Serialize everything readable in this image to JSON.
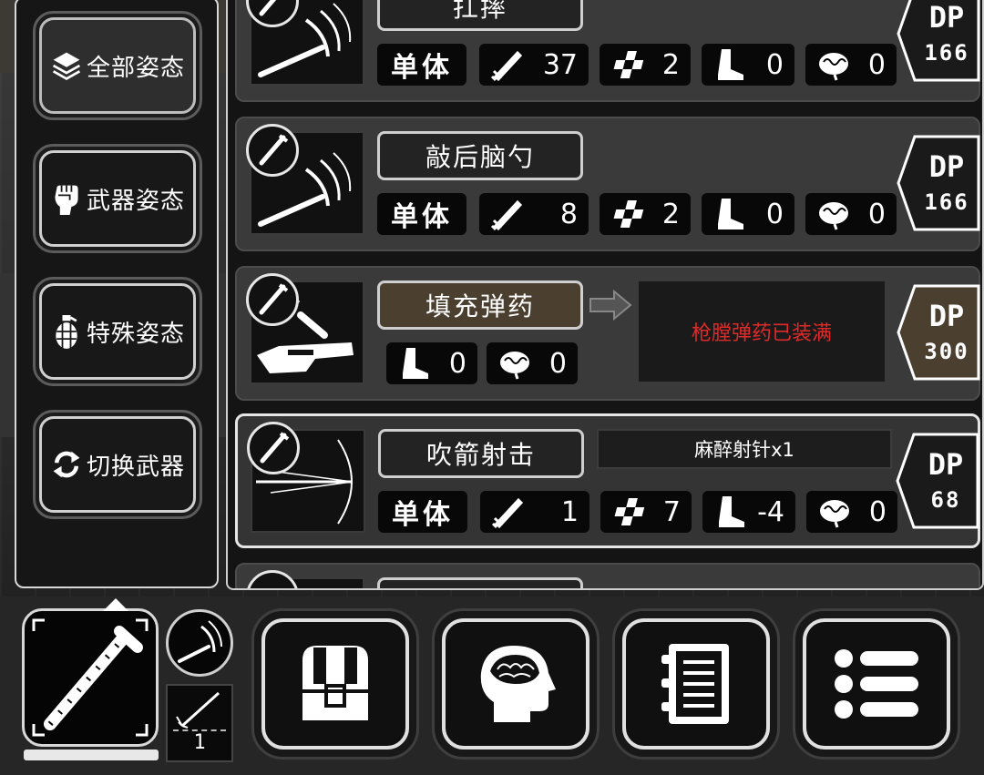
{
  "stance_menu": {
    "items": [
      {
        "label": "全部姿态",
        "icon": "layers-icon"
      },
      {
        "label": "武器姿态",
        "icon": "fist-icon"
      },
      {
        "label": "特殊姿态",
        "icon": "grenade-icon"
      },
      {
        "label": "切换武器",
        "icon": "swap-icon"
      }
    ]
  },
  "skills": [
    {
      "name": "扛摔",
      "target": "单体",
      "attack": "37",
      "range": "2",
      "move": "0",
      "mind": "0",
      "dp_label": "DP",
      "dp": "166"
    },
    {
      "name": "敲后脑勺",
      "target": "单体",
      "attack": "8",
      "range": "2",
      "move": "0",
      "mind": "0",
      "dp_label": "DP",
      "dp": "166"
    },
    {
      "name": "填充弹药",
      "move": "0",
      "mind": "0",
      "info": "枪膛弹药已装满",
      "dp_label": "DP",
      "dp": "300"
    },
    {
      "name": "吹箭射击",
      "note": "麻醉射针x1",
      "target": "单体",
      "attack": "1",
      "range": "7",
      "move": "-4",
      "mind": "0",
      "dp_label": "DP",
      "dp": "68"
    }
  ],
  "bottom_bar": {
    "ammo_count": "1",
    "weapon_durability": 1.0,
    "menu_buttons": [
      "backpack-icon",
      "brain-head-icon",
      "notebook-icon",
      "list-icon"
    ]
  },
  "colors": {
    "panel_bg": "#141414",
    "card_bg": "#3a3a3a",
    "name_brown": "#4b3f30",
    "alert_red": "#e02a2a"
  }
}
